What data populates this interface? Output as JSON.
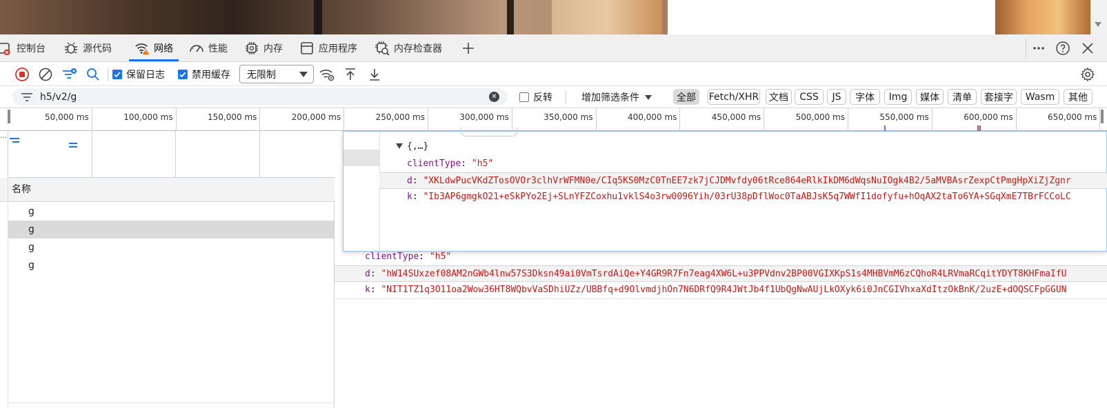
{
  "tabs": [
    {
      "label": "控制台",
      "icon": "console-icon"
    },
    {
      "label": "源代码",
      "icon": "bug-icon"
    },
    {
      "label": "网络",
      "icon": "wifi-warning-icon"
    },
    {
      "label": "性能",
      "icon": "speedometer-icon"
    },
    {
      "label": "内存",
      "icon": "chip-icon"
    },
    {
      "label": "应用程序",
      "icon": "app-window-icon"
    },
    {
      "label": "内存检查器",
      "icon": "memory-inspector-icon"
    }
  ],
  "toolbar": {
    "preserve_log_label": "保留日志",
    "disable_cache_label": "禁用缓存",
    "throttle_value": "无限制"
  },
  "filter": {
    "value": "h5/v2/g",
    "invert_label": "反转",
    "more_filters_label": "增加筛选条件",
    "types": [
      "全部",
      "Fetch/XHR",
      "文档",
      "CSS",
      "JS",
      "字体",
      "Img",
      "媒体",
      "清单",
      "套接字",
      "Wasm",
      "其他"
    ]
  },
  "timeline": {
    "ticks": [
      "50,000 ms",
      "100,000 ms",
      "150,000 ms",
      "200,000 ms",
      "250,000 ms",
      "300,000 ms",
      "350,000 ms",
      "400,000 ms",
      "450,000 ms",
      "500,000 ms",
      "550,000 ms",
      "600,000 ms",
      "650,000 ms"
    ]
  },
  "requests": {
    "header": "名称",
    "rows": [
      "g",
      "g",
      "g",
      "g"
    ],
    "selected_index": 1
  },
  "popover": {
    "object_label": "{,…}",
    "client_type_key": "clientType",
    "client_type_value": "\"h5\"",
    "d_key": "d",
    "d_value": "\"XKLdwPucVKdZTosOVOr3clhVrWFMN0e/CIq5KS0MzC0TnEE7zk7jCJDMvfdy06tRce864eRlkIkDM6dWqsNuIOgk4B2/5aMVBAsrZexpCtPmgHpXiZjZgnr",
    "k_key": "k",
    "k_value": "\"Ib3AP6gmgkO21+eSkPYo2Ej+SLnYFZCoxhu1vklS4o3rw0096Yih/03rU38pDflWoc0TaABJsK5q7WWfI1dofyfu+hOqAX2taTo6YA+SGqXmE7TBrFCCoLC"
  },
  "detail": {
    "client_type_key": "clientType",
    "client_type_value": "\"h5\"",
    "d_key": "d",
    "d_value": "\"hW14SUxzef08AM2nGWb4lnw57S3Dksn49ai0VmTsrdAiQe+Y4GR9R7Fn7eag4XW6L+u3PPVdnv2BP00VGIXKpS1s4MHBVmM6zCQhoR4LRVmaRCqitYDYT8KHFmaIfU",
    "k_key": "k",
    "k_value": "\"NIT1TZ1q3O11oa2Wow36HT8WQbvVaSDhiUZz/UBBfq+d9OlvmdjhOn7N6DRfQ9R4JWtJb4f1UbQgNwAUjLkOXyk6i0JnCGIVhxaXdItzOkBnK/2uzE+dOQSCFpGGUN"
  },
  "colors": {
    "accent": "#1a73e8",
    "record_red": "#d93025",
    "json_key": "#881391",
    "json_string": "#c41a16"
  }
}
